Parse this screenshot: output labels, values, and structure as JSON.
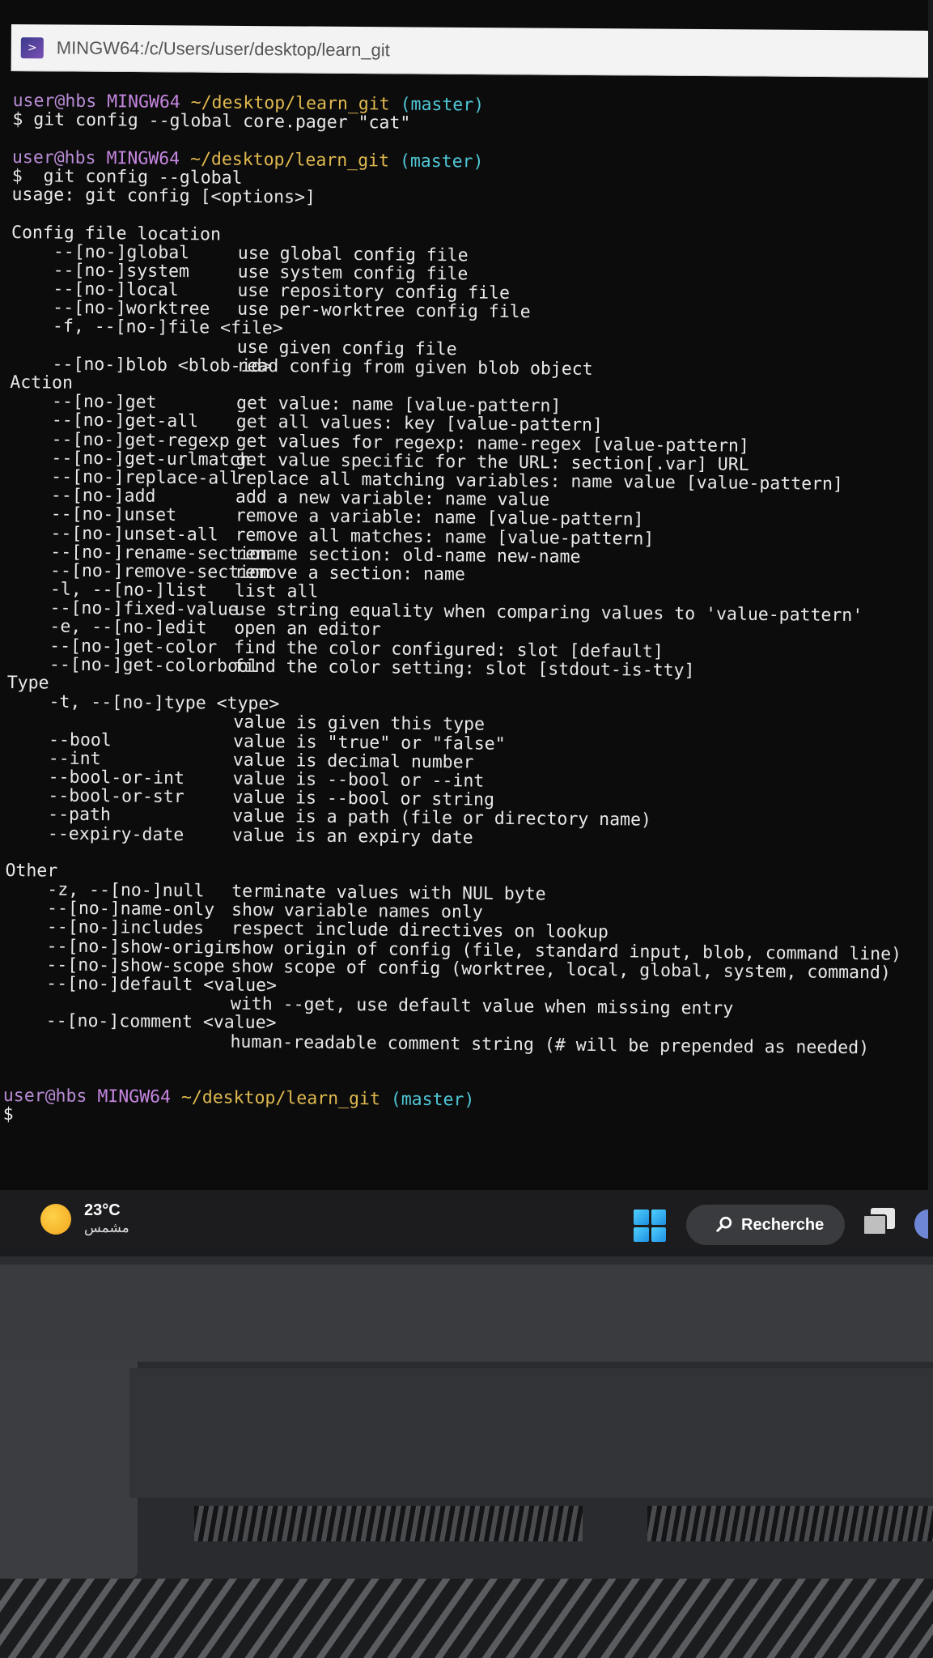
{
  "window": {
    "title": "MINGW64:/c/Users/user/desktop/learn_git"
  },
  "terminal": {
    "prompt": {
      "user": "user@hbs",
      "host": "MINGW64",
      "path": "~/desktop/learn_git",
      "branch": "(master)"
    },
    "cmd1": "$ git config --global core.pager \"cat\"",
    "cmd2": "$  git config --global",
    "usage": "usage: git config [<options>]",
    "sections": {
      "config_file": {
        "heading": "Config file location",
        "rows": [
          {
            "opt": "--[no-]global",
            "desc": "use global config file"
          },
          {
            "opt": "--[no-]system",
            "desc": "use system config file"
          },
          {
            "opt": "--[no-]local",
            "desc": "use repository config file"
          },
          {
            "opt": "--[no-]worktree",
            "desc": "use per-worktree config file"
          },
          {
            "opt": "-f, --[no-]file <file>",
            "desc": ""
          },
          {
            "opt": "",
            "desc": "use given config file"
          },
          {
            "opt": "--[no-]blob <blob-id>",
            "desc": "read config from given blob object"
          }
        ]
      },
      "action": {
        "heading": "Action",
        "rows": [
          {
            "opt": "--[no-]get",
            "desc": "get value: name [value-pattern]"
          },
          {
            "opt": "--[no-]get-all",
            "desc": "get all values: key [value-pattern]"
          },
          {
            "opt": "--[no-]get-regexp",
            "desc": "get values for regexp: name-regex [value-pattern]"
          },
          {
            "opt": "--[no-]get-urlmatch",
            "desc": "get value specific for the URL: section[.var] URL"
          },
          {
            "opt": "--[no-]replace-all",
            "desc": "replace all matching variables: name value [value-pattern]"
          },
          {
            "opt": "--[no-]add",
            "desc": "add a new variable: name value"
          },
          {
            "opt": "--[no-]unset",
            "desc": "remove a variable: name [value-pattern]"
          },
          {
            "opt": "--[no-]unset-all",
            "desc": "remove all matches: name [value-pattern]"
          },
          {
            "opt": "--[no-]rename-section",
            "desc": "rename section: old-name new-name"
          },
          {
            "opt": "--[no-]remove-section",
            "desc": "remove a section: name"
          },
          {
            "opt": "-l, --[no-]list",
            "desc": "list all"
          },
          {
            "opt": "--[no-]fixed-value",
            "desc": "use string equality when comparing values to 'value-pattern'"
          },
          {
            "opt": "-e, --[no-]edit",
            "desc": "open an editor"
          },
          {
            "opt": "--[no-]get-color",
            "desc": "find the color configured: slot [default]"
          },
          {
            "opt": "--[no-]get-colorbool",
            "desc": "find the color setting: slot [stdout-is-tty]"
          }
        ]
      },
      "type": {
        "heading": "Type",
        "rows": [
          {
            "opt": "-t, --[no-]type <type>",
            "desc": ""
          },
          {
            "opt": "",
            "desc": "value is given this type"
          },
          {
            "opt": "--bool",
            "desc": "value is \"true\" or \"false\""
          },
          {
            "opt": "--int",
            "desc": "value is decimal number"
          },
          {
            "opt": "--bool-or-int",
            "desc": "value is --bool or --int"
          },
          {
            "opt": "--bool-or-str",
            "desc": "value is --bool or string"
          },
          {
            "opt": "--path",
            "desc": "value is a path (file or directory name)"
          },
          {
            "opt": "--expiry-date",
            "desc": "value is an expiry date"
          }
        ]
      },
      "other": {
        "heading": "Other",
        "rows": [
          {
            "opt": "-z, --[no-]null",
            "desc": "terminate values with NUL byte"
          },
          {
            "opt": "--[no-]name-only",
            "desc": "show variable names only"
          },
          {
            "opt": "--[no-]includes",
            "desc": "respect include directives on lookup"
          },
          {
            "opt": "--[no-]show-origin",
            "desc": "show origin of config (file, standard input, blob, command line)"
          },
          {
            "opt": "--[no-]show-scope",
            "desc": "show scope of config (worktree, local, global, system, command)"
          },
          {
            "opt": "--[no-]default <value>",
            "desc": ""
          },
          {
            "opt": "",
            "desc": "with --get, use default value when missing entry"
          },
          {
            "opt": "--[no-]comment <value>",
            "desc": ""
          },
          {
            "opt": "",
            "desc": "human-readable comment string (# will be prepended as needed)"
          }
        ]
      }
    },
    "final_prompt_symbol": "$"
  },
  "taskbar": {
    "weather_temp": "23°C",
    "weather_desc": "مشمس",
    "weather_icon": "sun-icon",
    "search_label": "Recherche",
    "search_icon": "magnifier-icon",
    "start_icon": "windows-start-icon",
    "taskview_icon": "task-view-icon",
    "chat_icon": "chat-icon"
  }
}
